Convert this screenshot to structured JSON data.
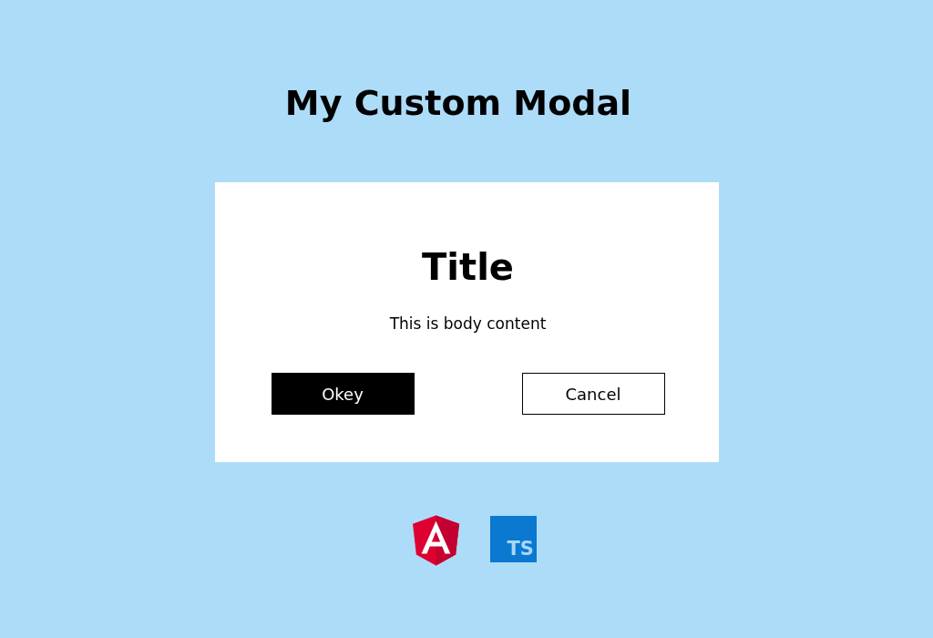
{
  "page": {
    "heading": "My Custom Modal"
  },
  "modal": {
    "title": "Title",
    "body": "This is body content",
    "buttons": [
      {
        "label": "Okey",
        "kind": "primary"
      },
      {
        "label": "Cancel",
        "kind": "secondary"
      }
    ]
  },
  "logos": [
    {
      "kind": "angular"
    },
    {
      "kind": "typescript",
      "text": "TS"
    }
  ]
}
